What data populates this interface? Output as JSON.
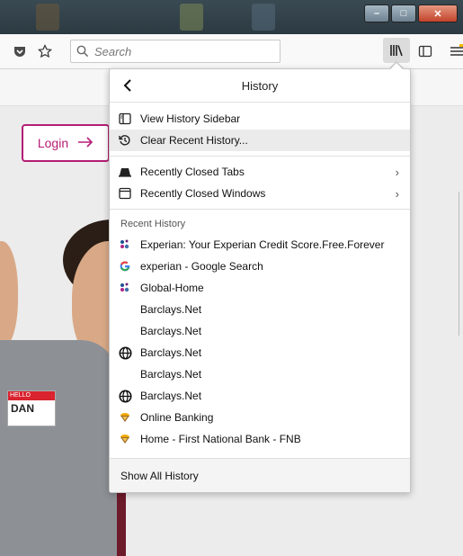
{
  "toolbar": {
    "search_placeholder": "Search"
  },
  "page": {
    "login_label": "Login",
    "badge_hello": "HELLO",
    "badge_name": "DAN"
  },
  "menu": {
    "title": "History",
    "actions": [
      {
        "label": "View History Sidebar",
        "icon": "sidebar-icon"
      },
      {
        "label": "Clear Recent History...",
        "icon": "clear-history-icon"
      }
    ],
    "closed": [
      {
        "label": "Recently Closed Tabs",
        "icon": "tab-icon"
      },
      {
        "label": "Recently Closed Windows",
        "icon": "window-icon"
      }
    ],
    "recent_label": "Recent History",
    "recent": [
      {
        "label": "Experian: Your Experian Credit Score.Free.Forever",
        "icon": "experian-favicon"
      },
      {
        "label": "experian - Google Search",
        "icon": "google-favicon"
      },
      {
        "label": "Global-Home",
        "icon": "experian-favicon"
      },
      {
        "label": "Barclays.Net",
        "icon": ""
      },
      {
        "label": "Barclays.Net",
        "icon": ""
      },
      {
        "label": "Barclays.Net",
        "icon": "globe-icon"
      },
      {
        "label": "Barclays.Net",
        "icon": ""
      },
      {
        "label": "Barclays.Net",
        "icon": "globe-icon"
      },
      {
        "label": "Online Banking",
        "icon": "fnb-favicon"
      },
      {
        "label": "Home - First National Bank - FNB",
        "icon": "fnb-favicon"
      }
    ],
    "show_all": "Show All History"
  },
  "colors": {
    "accent": "#b51d74",
    "menu_highlight": "#ebebeb"
  }
}
